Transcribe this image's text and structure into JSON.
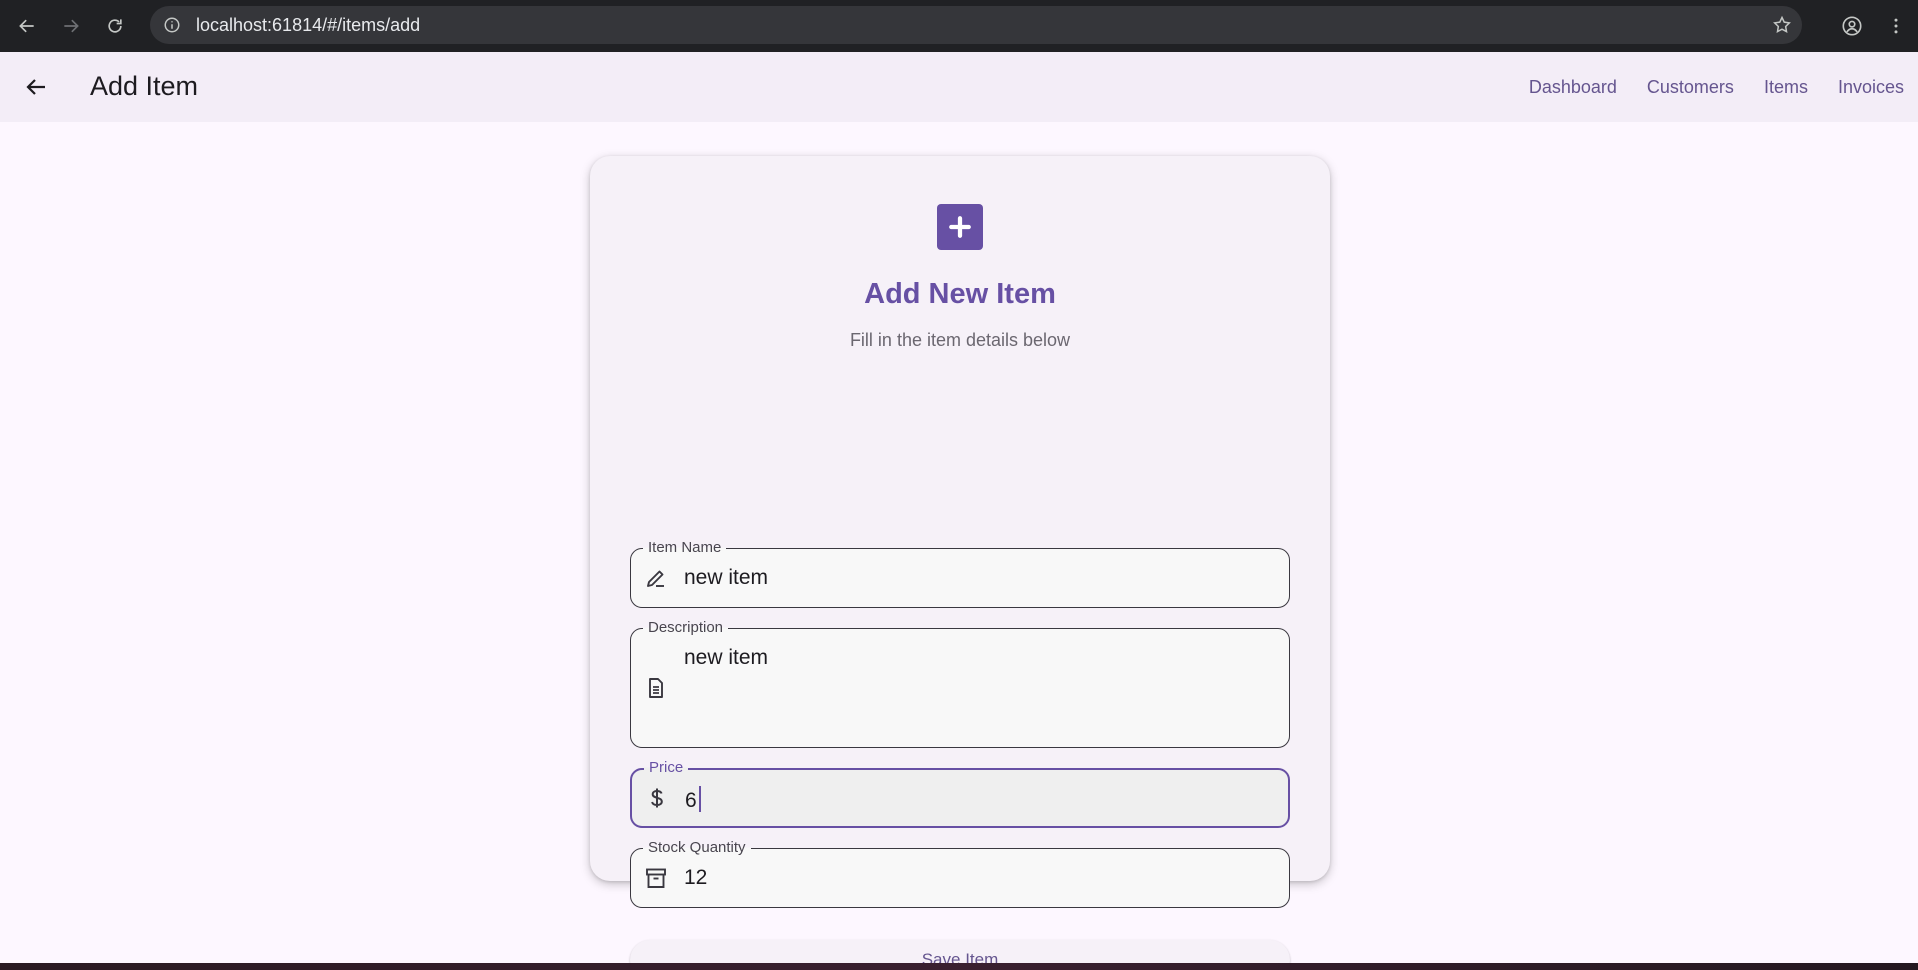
{
  "browser": {
    "url": "localhost:61814/#/items/add"
  },
  "app_bar": {
    "title": "Add Item",
    "nav": [
      {
        "label": "Dashboard"
      },
      {
        "label": "Customers"
      },
      {
        "label": "Items"
      },
      {
        "label": "Invoices"
      }
    ]
  },
  "form": {
    "title": "Add New Item",
    "subtitle": "Fill in the item details below",
    "fields": {
      "name": {
        "label": "Item Name",
        "value": "new item",
        "icon": "edit-pen-icon"
      },
      "description": {
        "label": "Description",
        "value": "new item",
        "icon": "document-icon"
      },
      "price": {
        "label": "Price",
        "value": "6",
        "icon": "dollar-icon"
      },
      "stock": {
        "label": "Stock Quantity",
        "value": "12",
        "icon": "archive-box-icon"
      }
    },
    "save_label": "Save Item"
  },
  "colors": {
    "primary": "#6750a4",
    "nav_link": "#65558f",
    "app_bar_bg": "#f3edf7",
    "page_bg": "#fdf7ff"
  }
}
